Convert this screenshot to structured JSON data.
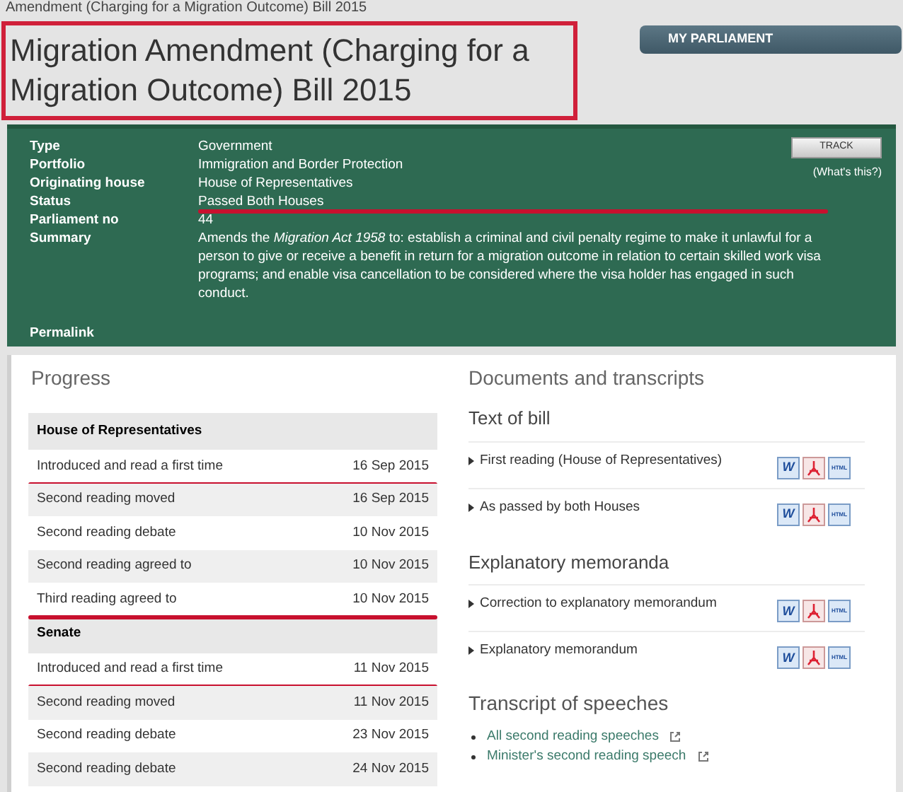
{
  "breadcrumb": "Amendment (Charging for a Migration Outcome) Bill 2015",
  "title": {
    "text": "Migration Amendment (Charging for a Migration Outcome) Bill 2015",
    "boxed": true
  },
  "my_parliament": "MY PARLIAMENT",
  "details": [
    {
      "label": "Type",
      "value": "Government",
      "marked": false
    },
    {
      "label": "Portfolio",
      "value": "Immigration and Border Protection",
      "marked": false
    },
    {
      "label": "Originating house",
      "value": "House of Representatives",
      "marked": false
    },
    {
      "label": "Status",
      "value": "Passed Both Houses",
      "marked": true
    },
    {
      "label": "Parliament no",
      "value": "44",
      "marked": false
    },
    {
      "label": "Summary",
      "value": "Amends the *Migration Act 1958* to: establish a criminal and civil penalty regime to make it unlawful for a person to give or receive a benefit in return for a migration outcome in relation to certain skilled work visa programs; and enable visa cancellation to be considered where the visa holder has engaged in such conduct.",
      "marked": false
    }
  ],
  "permalink": "Permalink",
  "track_button": "TRACK",
  "whats_this": "(What's this?)",
  "progress": {
    "heading": "Progress",
    "groups": [
      {
        "house": "House of Representatives",
        "rows": [
          {
            "stage": "Introduced and read a first time",
            "date": "16 Sep 2015",
            "marked": true
          },
          {
            "stage": "Second reading moved",
            "date": "16 Sep 2015",
            "marked": false
          },
          {
            "stage": "Second reading debate",
            "date": "10 Nov 2015",
            "marked": false
          },
          {
            "stage": "Second reading agreed to",
            "date": "10 Nov 2015",
            "marked": false
          },
          {
            "stage": "Third reading agreed to",
            "date": "10 Nov 2015",
            "marked": true
          }
        ]
      },
      {
        "house": "Senate",
        "rows": [
          {
            "stage": "Introduced and read a first time",
            "date": "11 Nov 2015",
            "marked": true
          },
          {
            "stage": "Second reading moved",
            "date": "11 Nov 2015",
            "marked": false
          },
          {
            "stage": "Second reading debate",
            "date": "23 Nov 2015",
            "marked": false
          },
          {
            "stage": "Second reading debate",
            "date": "24 Nov 2015",
            "marked": false
          }
        ]
      }
    ]
  },
  "documents": {
    "heading": "Documents and transcripts",
    "sections": [
      {
        "title": "Text of bill",
        "items": [
          {
            "label": "First reading (House of Representatives)",
            "formats": [
              {
                "kind": "word",
                "label": "W"
              },
              {
                "kind": "pdf"
              },
              {
                "kind": "html",
                "label": "HTML"
              }
            ]
          },
          {
            "label": "As passed by both Houses",
            "formats": [
              {
                "kind": "word",
                "label": "W"
              },
              {
                "kind": "pdf"
              },
              {
                "kind": "html",
                "label": "HTML"
              }
            ]
          }
        ]
      },
      {
        "title": "Explanatory memoranda",
        "items": [
          {
            "label": "Correction to explanatory memorandum",
            "formats": [
              {
                "kind": "word",
                "label": "W"
              },
              {
                "kind": "pdf"
              },
              {
                "kind": "html",
                "label": "HTML"
              }
            ]
          },
          {
            "label": "Explanatory memorandum",
            "formats": [
              {
                "kind": "word",
                "label": "W"
              },
              {
                "kind": "pdf"
              },
              {
                "kind": "html",
                "label": "HTML"
              }
            ]
          }
        ]
      }
    ],
    "speeches_title": "Transcript of speeches",
    "speeches": [
      "All second reading speeches",
      "Minister's second reading speech"
    ]
  }
}
